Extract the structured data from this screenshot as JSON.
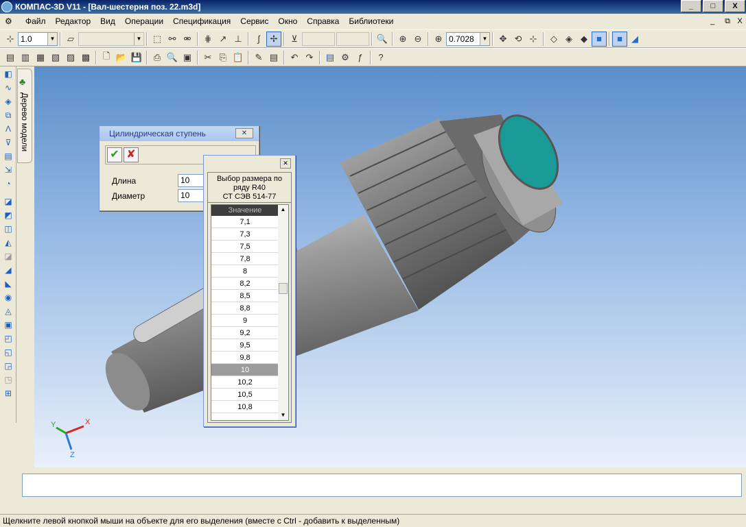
{
  "title": "КОМПАС-3D V11 - [Вал-шестерня поз. 22.m3d]",
  "window_buttons": {
    "min": "_",
    "max": "□",
    "close": "X"
  },
  "menu": [
    "Файл",
    "Редактор",
    "Вид",
    "Операции",
    "Спецификация",
    "Сервис",
    "Окно",
    "Справка",
    "Библиотеки"
  ],
  "mdi_buttons": {
    "min": "_",
    "restore": "⧉",
    "close": "X"
  },
  "toolbar1": {
    "step": "1.0",
    "zoom": "0.7028"
  },
  "tree_tab_label": "Дерево модели",
  "dialog_step": {
    "title": "Цилиндрическая ступень",
    "close": "✕",
    "length_label": "Длина",
    "length_value": "10",
    "diameter_label": "Диаметр",
    "diameter_value": "10"
  },
  "dialog_series": {
    "close": "✕",
    "header_line1": "Выбор размера по",
    "header_line2": "ряду R40",
    "header_line3": "СТ СЭВ 514-77",
    "column_header": "Значение",
    "values": [
      "7,1",
      "7,3",
      "7,5",
      "7,8",
      "8",
      "8,2",
      "8,5",
      "8,8",
      "9",
      "9,2",
      "9,5",
      "9,8",
      "10",
      "10,2",
      "10,5",
      "10,8"
    ],
    "selected": "10"
  },
  "axes": {
    "x": "X",
    "y": "Y",
    "z": "Z"
  },
  "status": "Щелкните левой кнопкой мыши на объекте для его выделения (вместе с Ctrl - добавить к выделенным)"
}
